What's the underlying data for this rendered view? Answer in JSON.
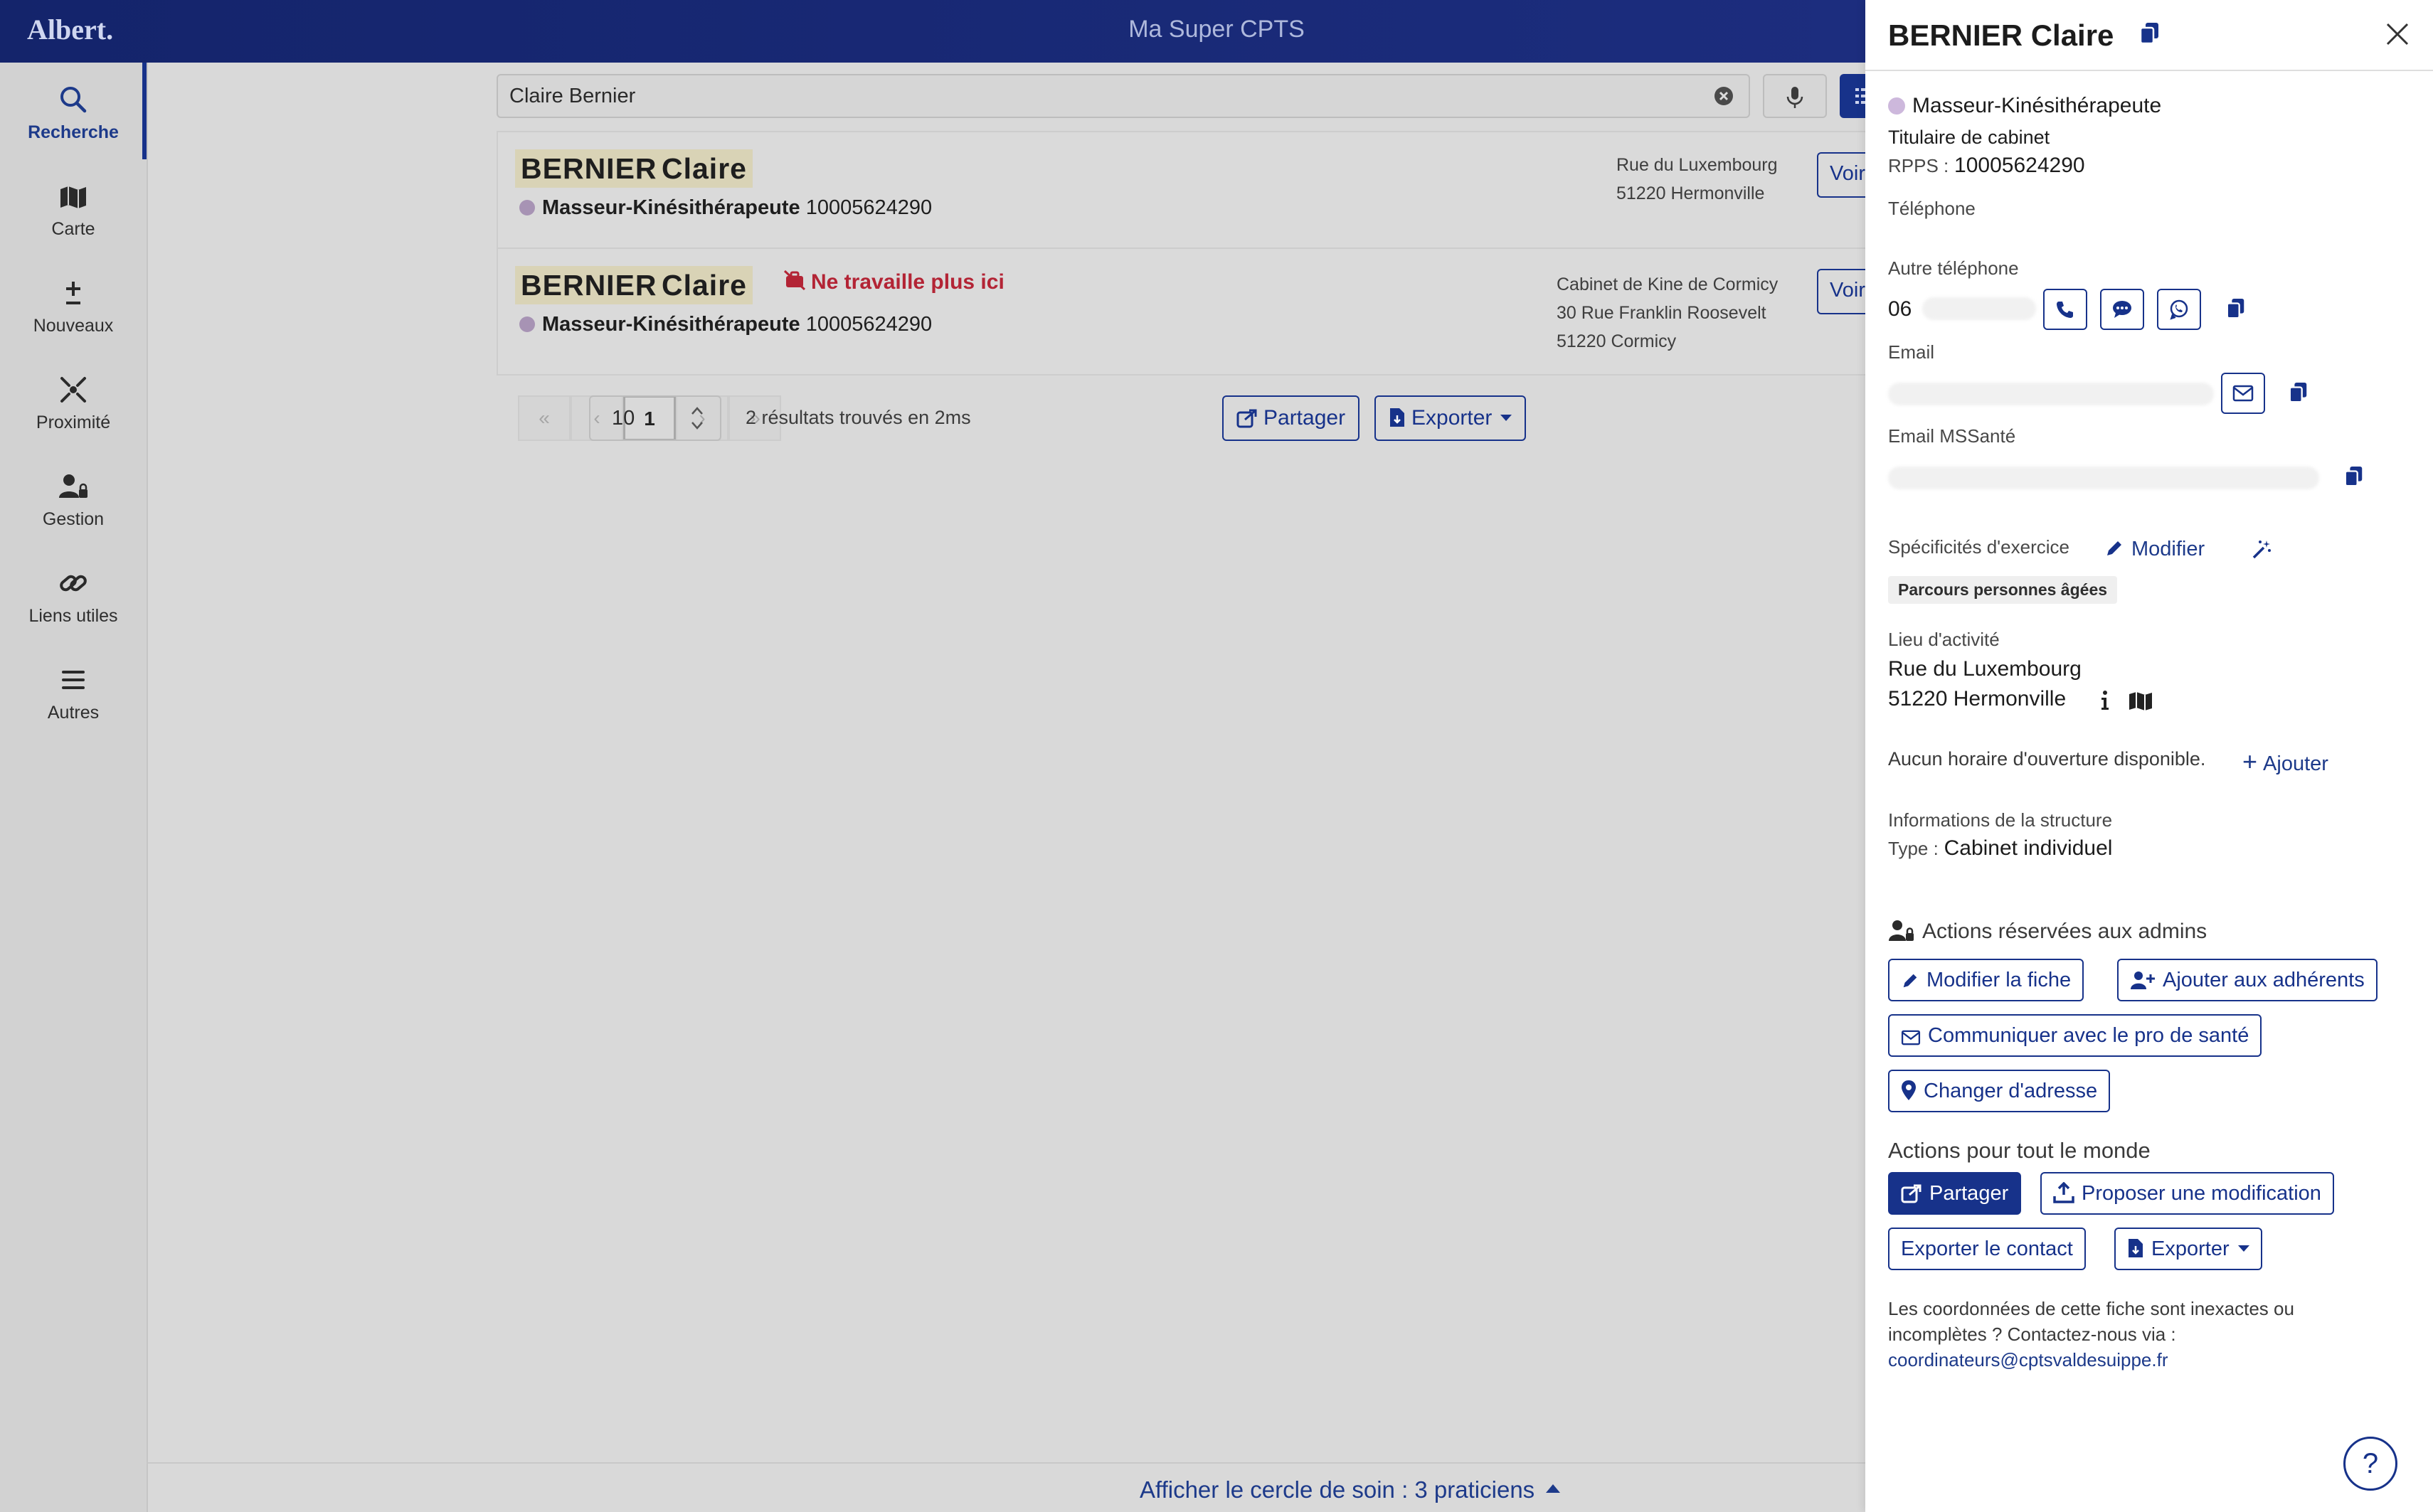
{
  "app": {
    "logo": "Albert.",
    "title": "Ma Super CPTS"
  },
  "nav": [
    {
      "label": "Recherche",
      "icon": "search-icon"
    },
    {
      "label": "Carte",
      "icon": "map-icon"
    },
    {
      "label": "Nouveaux",
      "icon": "plus-minus-icon"
    },
    {
      "label": "Proximité",
      "icon": "proximity-icon"
    },
    {
      "label": "Gestion",
      "icon": "user-lock-icon"
    },
    {
      "label": "Liens utiles",
      "icon": "link-icon"
    },
    {
      "label": "Autres",
      "icon": "menu-icon"
    }
  ],
  "search": {
    "value": "Claire Bernier",
    "placeholder": ""
  },
  "results": [
    {
      "last_name": "BERNIER",
      "first_name": "Claire",
      "profession": "Masseur-Kinésithérapeute",
      "rpps": "10005624290",
      "warning": "",
      "address_lines": [
        "Rue du Luxembourg",
        "51220  Hermonville"
      ],
      "voir_label": "Voir"
    },
    {
      "last_name": "BERNIER",
      "first_name": "Claire",
      "profession": "Masseur-Kinésithérapeute",
      "rpps": "10005624290",
      "warning": "Ne travaille plus ici",
      "address_lines": [
        "Cabinet de Kine de Cormicy",
        "30 Rue Franklin Roosevelt",
        "51220  Cormicy"
      ],
      "voir_label": "Voir"
    }
  ],
  "pagination": {
    "first": "«",
    "prev": "‹",
    "current": "1",
    "next": "›",
    "last": "»",
    "per_page": "10",
    "count_text": "2 résultats trouvés en 2ms",
    "share_label": "Partager",
    "export_label": "Exporter"
  },
  "bottom": {
    "circle_link": "Afficher le cercle de soin : 3 praticiens"
  },
  "panel": {
    "title": "BERNIER Claire",
    "profession": "Masseur-Kinésithérapeute",
    "role": "Titulaire de cabinet",
    "rpps_label": "RPPS :",
    "rpps_value": "10005624290",
    "telephone_label": "Téléphone",
    "other_phone_label": "Autre téléphone",
    "other_phone_prefix": "06 ",
    "email_label": "Email",
    "mssante_label": "Email MSSanté",
    "specificities_label": "Spécificités d'exercice",
    "modify_label": "Modifier",
    "tag": "Parcours personnes âgées",
    "activity_label": "Lieu d'activité",
    "activity_street": "Rue du Luxembourg",
    "activity_city": "51220  Hermonville",
    "hours_text": "Aucun horaire d'ouverture disponible.",
    "hours_add": "Ajouter",
    "structure_label": "Informations de la structure",
    "structure_type_label": "Type :",
    "structure_type_value": "Cabinet individuel",
    "admin_section": "Actions réservées aux admins",
    "btn_edit_sheet": "Modifier la fiche",
    "btn_add_members": "Ajouter aux adhérents",
    "btn_communicate": "Communiquer avec le pro de santé",
    "btn_change_address": "Changer d'adresse",
    "public_section": "Actions pour tout le monde",
    "btn_share": "Partager",
    "btn_propose": "Proposer une modification",
    "btn_export_contact": "Exporter le contact",
    "btn_export": "Exporter",
    "footer_text_1": "Les coordonnées de cette fiche sont inexactes ou",
    "footer_text_2": "incomplètes ? Contactez-nous via :",
    "footer_email": "coordinateurs@cptsvaldesuippe.fr",
    "help": "?"
  },
  "colors": {
    "primary": "#17328a",
    "topbar": "#1c2d7e",
    "warning": "#b32435",
    "highlight": "#d9d3b6",
    "profession_dot": "#cdb8dc"
  }
}
